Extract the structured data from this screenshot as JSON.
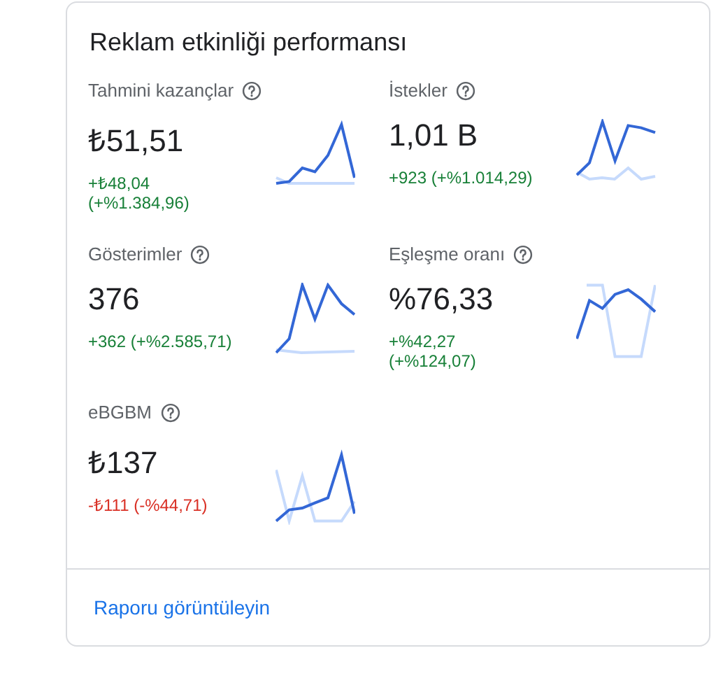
{
  "card": {
    "title": "Reklam etkinliği performansı",
    "metrics": [
      {
        "label": "Tahmini kazançlar",
        "value": "₺51,51",
        "change": [
          "+₺48,04",
          "(+%1.384,96)"
        ],
        "negative": false
      },
      {
        "label": "İstekler",
        "value": "1,01 B",
        "change": [
          "+923 (+%1.014,29)"
        ],
        "negative": false
      },
      {
        "label": "Gösterimler",
        "value": "376",
        "change": [
          "+362 (+%2.585,71)"
        ],
        "negative": false
      },
      {
        "label": "Eşleşme oranı",
        "value": "%76,33",
        "change": [
          "+%42,27",
          "(+%124,07)"
        ],
        "negative": false
      },
      {
        "label": "eBGBM",
        "value": "₺137",
        "change": [
          "-₺111 (-%44,71)"
        ],
        "negative": true
      }
    ],
    "link": "Raporu görüntüleyin"
  }
}
